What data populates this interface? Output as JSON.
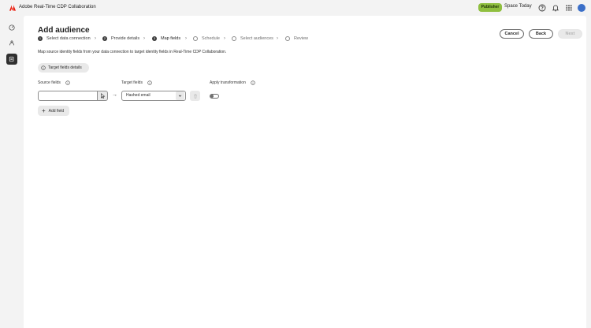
{
  "app": {
    "title": "Adobe Real-Time CDP Collaboration",
    "logo_icon": "adobe-logo-icon",
    "brand_color": "#eb1000"
  },
  "header": {
    "badge": "Publisher",
    "org_name": "Space Today",
    "icons": [
      "help-icon",
      "bell-icon",
      "apps-grid-icon",
      "avatar"
    ]
  },
  "sidebar": {
    "items": [
      {
        "icon": "dashboard-icon"
      },
      {
        "icon": "connections-icon"
      },
      {
        "icon": "audiences-icon",
        "active": true
      }
    ],
    "collapse_icon": "expand-chevrons-icon"
  },
  "page": {
    "title": "Add audience",
    "buttons": {
      "cancel": "Cancel",
      "back": "Back",
      "next": "Next"
    },
    "steps": [
      {
        "num": "1",
        "label": "Select data connection",
        "state": "done"
      },
      {
        "num": "2",
        "label": "Provide details",
        "state": "done"
      },
      {
        "num": "3",
        "label": "Map fields",
        "state": "current"
      },
      {
        "num": "",
        "label": "Schedule",
        "state": "todo"
      },
      {
        "num": "",
        "label": "Select audiences",
        "state": "todo"
      },
      {
        "num": "",
        "label": "Review",
        "state": "todo"
      }
    ],
    "description": "Map source identity fields from your data connection to target identity fields in Real-Time CDP Collaboration.",
    "details_button": "Target fields details",
    "columns": {
      "source": "Source fields",
      "target": "Target fields",
      "transform": "Apply transformation"
    },
    "mapping_row": {
      "source_value": "",
      "source_placeholder": "",
      "target_value": "Hashed email",
      "transformation_on": false
    },
    "add_field": "Add field"
  }
}
